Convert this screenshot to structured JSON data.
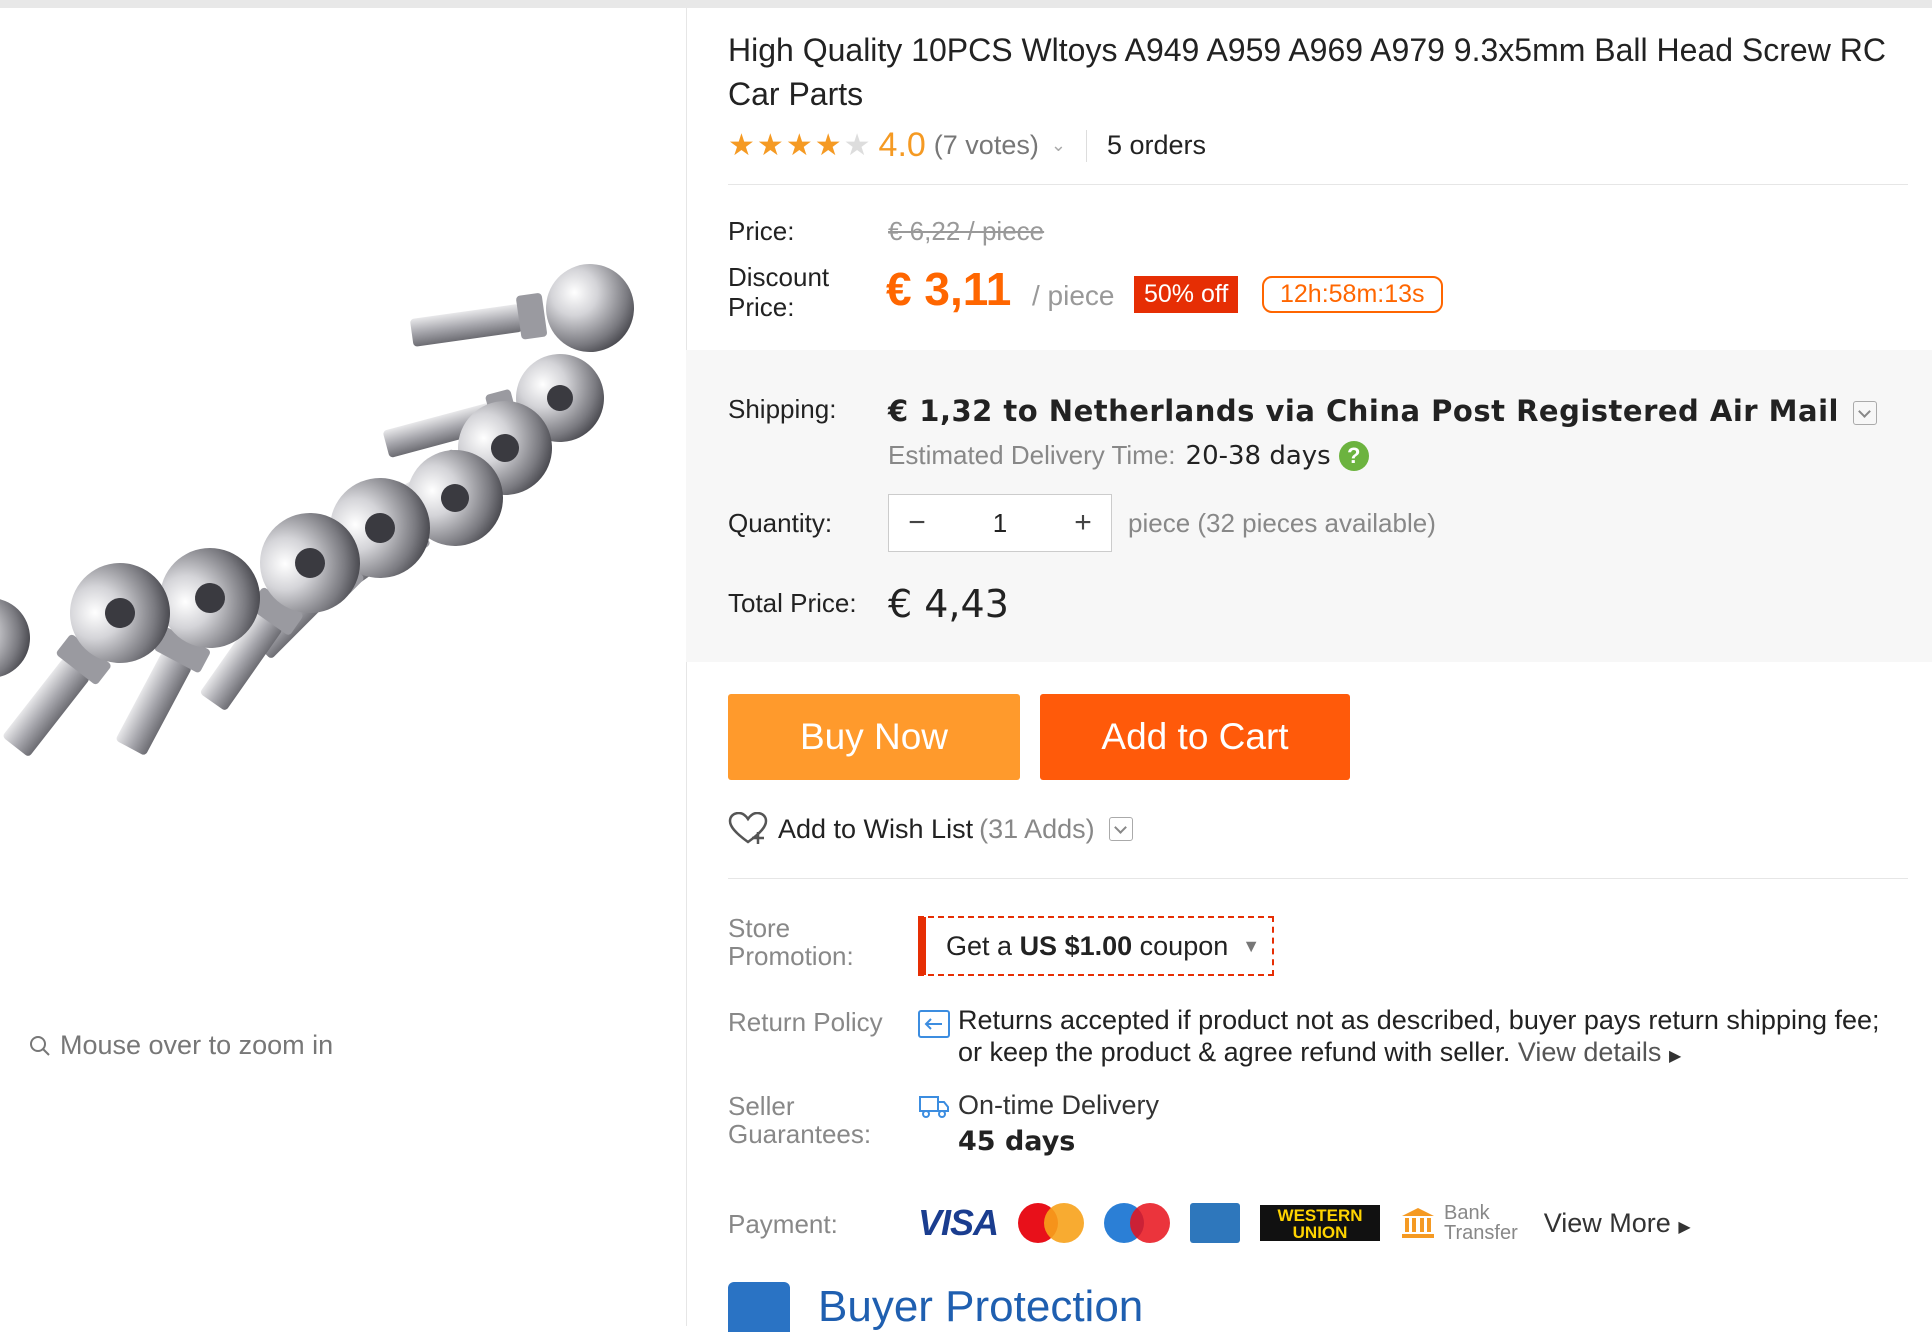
{
  "product": {
    "title": "High Quality 10PCS Wltoys A949 A959 A969 A979 9.3x5mm Ball Head Screw RC Car Parts",
    "rating_value": "4.0",
    "rating_stars": 4,
    "votes": "(7 votes)",
    "orders": "5 orders"
  },
  "image_panel": {
    "zoom_hint": "Mouse over to zoom in"
  },
  "price": {
    "price_label": "Price:",
    "old_price": "€ 6,22 / piece",
    "discount_label": "Discount Price:",
    "discount_price": "€ 3,11",
    "per_unit": "/ piece",
    "discount_badge": "50% off",
    "countdown": "12h:58m:13s"
  },
  "shipping": {
    "label": "Shipping:",
    "text": "€ 1,32 to Netherlands via China Post Registered Air Mail",
    "est_label": "Estimated Delivery Time:",
    "est_days": "20-38 days"
  },
  "quantity": {
    "label": "Quantity:",
    "value": "1",
    "minus": "−",
    "plus": "+",
    "availability": "piece (32 pieces available)"
  },
  "total": {
    "label": "Total Price:",
    "value": "€ 4,43"
  },
  "actions": {
    "buy_now": "Buy Now",
    "add_to_cart": "Add to Cart",
    "wishlist": "Add to Wish List",
    "wishlist_count": "(31 Adds)"
  },
  "promotion": {
    "label": "Store Promotion:",
    "coupon_prefix": "Get a",
    "coupon_amount": "US $1.00",
    "coupon_suffix": "coupon"
  },
  "return_policy": {
    "label": "Return Policy",
    "text_line1": "Returns accepted if product not as described, buyer pays return shipping fee;",
    "text_line2": "or keep the product & agree refund with seller.",
    "link": "View details"
  },
  "guarantees": {
    "label": "Seller Guarantees:",
    "delivery": "On-time Delivery",
    "days": "45 days"
  },
  "payment": {
    "label": "Payment:",
    "visa": "VISA",
    "western_union_1": "WESTERN",
    "western_union_2": "UNION",
    "bank_1": "Bank",
    "bank_2": "Transfer",
    "view_more": "View More"
  },
  "buyer_protection": {
    "title": "Buyer Protection"
  },
  "colors": {
    "accent_orange": "#ff6600",
    "buy_now": "#ff9a2c",
    "add_to_cart": "#ff5a0a",
    "badge_red": "#e62e04",
    "star": "#f59a23",
    "help_green": "#6cb33f"
  }
}
